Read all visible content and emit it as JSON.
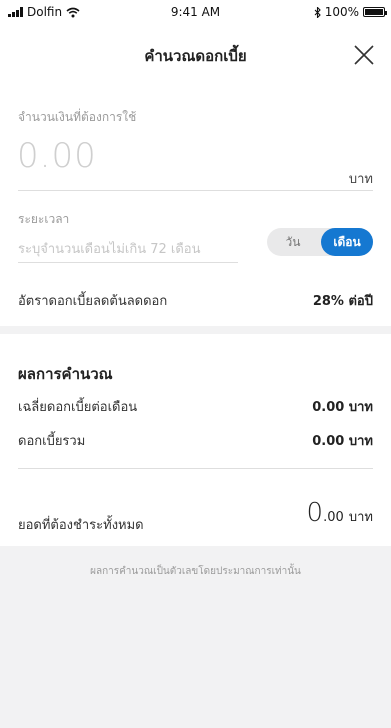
{
  "status_bar": {
    "carrier": "Dolfin",
    "time": "9:41 AM",
    "battery": "100%",
    "battery_level": 1.0
  },
  "header": {
    "title": "คำนวณดอกเบี้ย"
  },
  "form": {
    "amount_label": "จำนวนเงินที่ต้องการใช้",
    "amount_value": "0.00",
    "amount_unit": "บาท",
    "period_label": "ระยะเวลา",
    "period_placeholder": "ระบุจำนวนเดือนไม่เกิน 72 เดือน",
    "period_options": [
      "วัน",
      "เดือน"
    ],
    "period_selected": "เดือน",
    "rate_label": "อัตราดอกเบี้ยลดต้นลดดอก",
    "rate_value": "28% ต่อปี"
  },
  "result": {
    "title": "ผลการคำนวณ",
    "monthly_label": "เฉลี่ยดอกเบี้ยต่อเดือน",
    "monthly_value": "0.00 บาท",
    "total_interest_label": "ดอกเบี้ยรวม",
    "total_interest_value": "0.00 บาท",
    "total_label": "ยอดที่ต้องชำระทั้งหมด",
    "total_int": "0",
    "total_dec": ".00",
    "total_unit": "บาท"
  },
  "note": "ผลการคำนวณเป็นตัวเลขโดยประมาณการเท่านั้น",
  "colors": {
    "accent": "#1578d1",
    "background": "#f2f2f3"
  },
  "icons": [
    "signal-icon",
    "wifi-icon",
    "bluetooth-icon",
    "battery-icon",
    "close-icon"
  ]
}
